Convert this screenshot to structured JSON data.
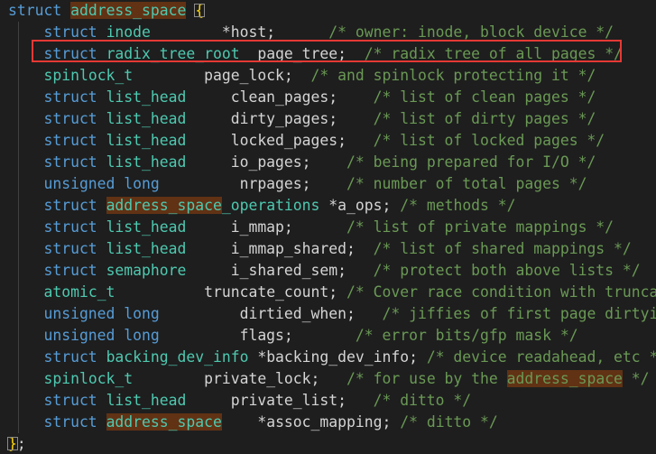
{
  "code_lines": [
    [
      {
        "t": "struct",
        "c": "kw"
      },
      {
        "t": " ",
        "c": "id"
      },
      {
        "t": "address_space",
        "c": "type",
        "hl": true
      },
      {
        "t": " ",
        "c": "id"
      },
      {
        "t": "{",
        "c": "brace"
      }
    ],
    [
      {
        "t": "    struct ",
        "c": "kw"
      },
      {
        "t": "inode",
        "c": "type"
      },
      {
        "t": "        *host;",
        "c": "id"
      },
      {
        "t": "      /* owner: inode, block_device */",
        "c": "cmt"
      }
    ],
    [
      {
        "t": "    struct ",
        "c": "kw"
      },
      {
        "t": "radix_tree_root",
        "c": "type"
      },
      {
        "t": "  page_tree;",
        "c": "id"
      },
      {
        "t": "  /* radix tree of all pages */",
        "c": "cmt"
      }
    ],
    [
      {
        "t": "    ",
        "c": "id"
      },
      {
        "t": "spinlock_t",
        "c": "type"
      },
      {
        "t": "        page_lock;",
        "c": "id"
      },
      {
        "t": "  /* and spinlock protecting it */",
        "c": "cmt"
      }
    ],
    [
      {
        "t": "    struct ",
        "c": "kw"
      },
      {
        "t": "list_head",
        "c": "type"
      },
      {
        "t": "     clean_pages;",
        "c": "id"
      },
      {
        "t": "    /* list of clean pages */",
        "c": "cmt"
      }
    ],
    [
      {
        "t": "    struct ",
        "c": "kw"
      },
      {
        "t": "list_head",
        "c": "type"
      },
      {
        "t": "     dirty_pages;",
        "c": "id"
      },
      {
        "t": "    /* list of dirty pages */",
        "c": "cmt"
      }
    ],
    [
      {
        "t": "    struct ",
        "c": "kw"
      },
      {
        "t": "list_head",
        "c": "type"
      },
      {
        "t": "     locked_pages;",
        "c": "id"
      },
      {
        "t": "   /* list of locked pages */",
        "c": "cmt"
      }
    ],
    [
      {
        "t": "    struct ",
        "c": "kw"
      },
      {
        "t": "list_head",
        "c": "type"
      },
      {
        "t": "     io_pages;",
        "c": "id"
      },
      {
        "t": "    /* being prepared for I/O */",
        "c": "cmt"
      }
    ],
    [
      {
        "t": "    unsigned long",
        "c": "kw"
      },
      {
        "t": "         nrpages;",
        "c": "id"
      },
      {
        "t": "    /* number of total pages */",
        "c": "cmt"
      }
    ],
    [
      {
        "t": "    struct ",
        "c": "kw"
      },
      {
        "t": "address_space",
        "c": "type",
        "hl": true
      },
      {
        "t": "_operations",
        "c": "type"
      },
      {
        "t": " *a_ops;",
        "c": "id"
      },
      {
        "t": " /* methods */",
        "c": "cmt"
      }
    ],
    [
      {
        "t": "    struct ",
        "c": "kw"
      },
      {
        "t": "list_head",
        "c": "type"
      },
      {
        "t": "     i_mmap;",
        "c": "id"
      },
      {
        "t": "      /* list of private mappings */",
        "c": "cmt"
      }
    ],
    [
      {
        "t": "    struct ",
        "c": "kw"
      },
      {
        "t": "list_head",
        "c": "type"
      },
      {
        "t": "     i_mmap_shared;",
        "c": "id"
      },
      {
        "t": "  /* list of shared mappings */",
        "c": "cmt"
      }
    ],
    [
      {
        "t": "    struct ",
        "c": "kw"
      },
      {
        "t": "semaphore",
        "c": "type"
      },
      {
        "t": "     i_shared_sem;",
        "c": "id"
      },
      {
        "t": "   /* protect both above lists */",
        "c": "cmt"
      }
    ],
    [
      {
        "t": "    ",
        "c": "id"
      },
      {
        "t": "atomic_t",
        "c": "type"
      },
      {
        "t": "          truncate_count;",
        "c": "id"
      },
      {
        "t": " /* Cover race condition with truncate */",
        "c": "cmt"
      }
    ],
    [
      {
        "t": "    unsigned long",
        "c": "kw"
      },
      {
        "t": "         dirtied_when;",
        "c": "id"
      },
      {
        "t": "   /* jiffies of first page dirtying */",
        "c": "cmt"
      }
    ],
    [
      {
        "t": "    unsigned long",
        "c": "kw"
      },
      {
        "t": "         flags;",
        "c": "id"
      },
      {
        "t": "       /* error bits/gfp mask */",
        "c": "cmt"
      }
    ],
    [
      {
        "t": "    struct ",
        "c": "kw"
      },
      {
        "t": "backing_dev_info",
        "c": "type"
      },
      {
        "t": " *backing_dev_info;",
        "c": "id"
      },
      {
        "t": " /* device readahead, etc */",
        "c": "cmt"
      }
    ],
    [
      {
        "t": "    ",
        "c": "id"
      },
      {
        "t": "spinlock_t",
        "c": "type"
      },
      {
        "t": "        private_lock;",
        "c": "id"
      },
      {
        "t": "   /* for use by the ",
        "c": "cmt"
      },
      {
        "t": "address_space",
        "c": "cmt",
        "hl": true
      },
      {
        "t": " */",
        "c": "cmt"
      }
    ],
    [
      {
        "t": "    struct ",
        "c": "kw"
      },
      {
        "t": "list_head",
        "c": "type"
      },
      {
        "t": "     private_list;",
        "c": "id"
      },
      {
        "t": "   /* ditto */",
        "c": "cmt"
      }
    ],
    [
      {
        "t": "    struct ",
        "c": "kw"
      },
      {
        "t": "address_space",
        "c": "type",
        "hl": true
      },
      {
        "t": "    *assoc_mapping;",
        "c": "id"
      },
      {
        "t": " /* ditto */",
        "c": "cmt"
      }
    ],
    [
      {
        "t": "}",
        "c": "brace"
      },
      {
        "t": ";",
        "c": "punc"
      }
    ]
  ],
  "highlighted_line_index": 2,
  "colors": {
    "background": "#1e1e1e",
    "keyword": "#569cd6",
    "type": "#4ec9b0",
    "identifier": "#d4d4d4",
    "comment": "#6a9955",
    "brace": "#ffd700",
    "word_highlight": "#613214",
    "annotation_box": "#e53935"
  }
}
